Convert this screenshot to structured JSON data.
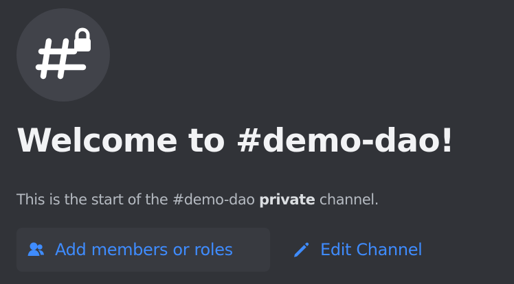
{
  "welcome": {
    "title": "Welcome to #demo-dao!",
    "description": {
      "before_channel": "This is the start of the ",
      "channel_name": "#demo-dao",
      "before_emphasis": " ",
      "emphasis": "private",
      "after_emphasis": " channel."
    },
    "channel_icon": "private-hashtag-icon",
    "actions": [
      {
        "label": "Add members or roles",
        "icon": "people-icon"
      },
      {
        "label": "Edit Channel",
        "icon": "pencil-icon"
      }
    ]
  },
  "colors": {
    "background": "#313338",
    "avatar_background": "#41434a",
    "title": "#f2f3f5",
    "secondary_text": "#b5bac1",
    "accent": "#3f8cff",
    "button_background": "#383a40"
  }
}
